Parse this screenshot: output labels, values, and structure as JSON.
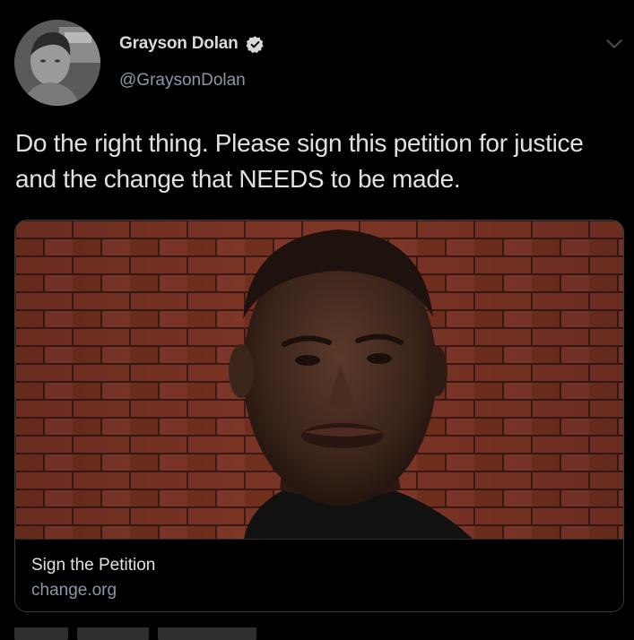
{
  "tweet": {
    "author_name": "Grayson Dolan",
    "author_handle": "@GraysonDolan",
    "text": "Do the right thing. Please sign this petition for justice and the change that NEEDS to be made."
  },
  "card": {
    "title": "Sign the Petition",
    "domain": "change.org"
  },
  "icons": {
    "verified": "verified-badge-icon",
    "menu": "chevron-down-icon"
  },
  "colors": {
    "background": "#000000",
    "primary_text": "#e1e1e1",
    "secondary_text": "#8899a6",
    "card_border": "#3a3a3a"
  }
}
